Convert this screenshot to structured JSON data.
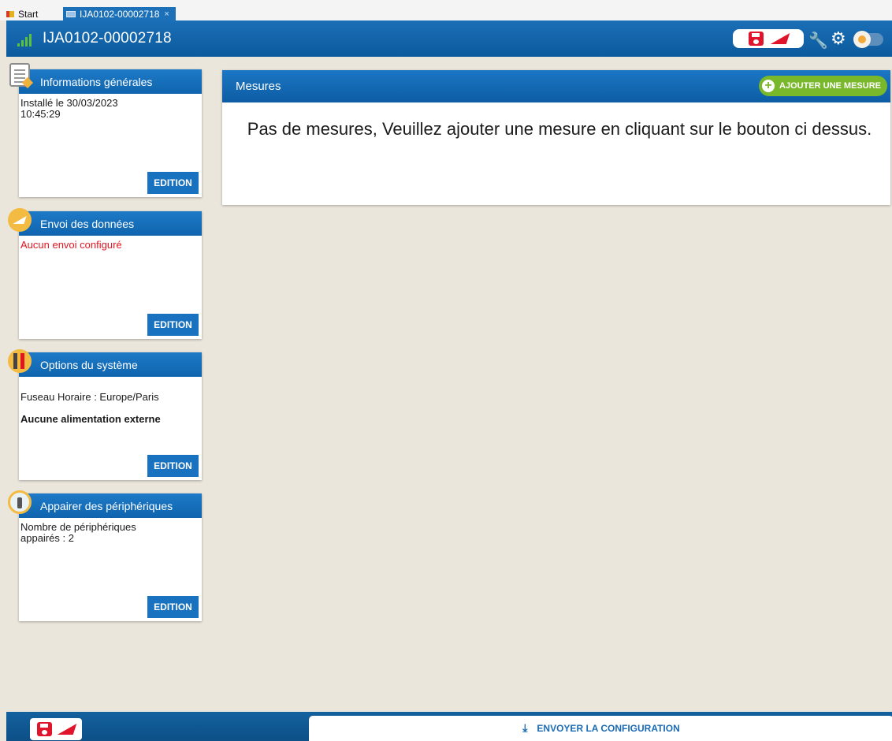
{
  "tabs": [
    {
      "label": "Start",
      "active": false
    },
    {
      "label": "IJA0102-00002718",
      "active": true,
      "close_glyph": "×"
    }
  ],
  "header": {
    "title": "IJA0102-00002718",
    "icons": [
      "signal-icon",
      "save-icon",
      "send-icon",
      "wrench-icon",
      "gear-icon",
      "toggle-switch"
    ],
    "accent_color": "#0f64ae"
  },
  "cards": [
    {
      "title": "Informations générales",
      "icon": "clipboard-icon",
      "lines": [
        "Installé le 30/03/2023\n10:45:29"
      ],
      "edit_label": "EDITION"
    },
    {
      "title": "Envoi des données",
      "icon": "send-icon",
      "alert_line": "Aucun envoi configuré",
      "edit_label": "EDITION"
    },
    {
      "title": "Options du système",
      "icon": "tools-icon",
      "line": "Fuseau Horaire : Europe/Paris",
      "strong_line": "Aucune alimentation externe",
      "edit_label": "EDITION"
    },
    {
      "title": "Appairer des périphériques",
      "icon": "pairing-icon",
      "line": "Nombre de périphériques\nappairés : 2",
      "edit_label": "EDITION"
    }
  ],
  "main": {
    "title": "Mesures",
    "add_label": "AJOUTER UNE MESURE",
    "empty_message": "Pas de mesures, Veuillez ajouter une mesure en cliquant sur le bouton ci dessus."
  },
  "footer": {
    "send_label": "ENVOYER LA CONFIGURATION",
    "icons": [
      "save-icon",
      "send-icon",
      "download-icon"
    ]
  },
  "colors": {
    "alert": "#e3151f",
    "add_button": "#78b82a",
    "brand_red": "#e0152b"
  }
}
